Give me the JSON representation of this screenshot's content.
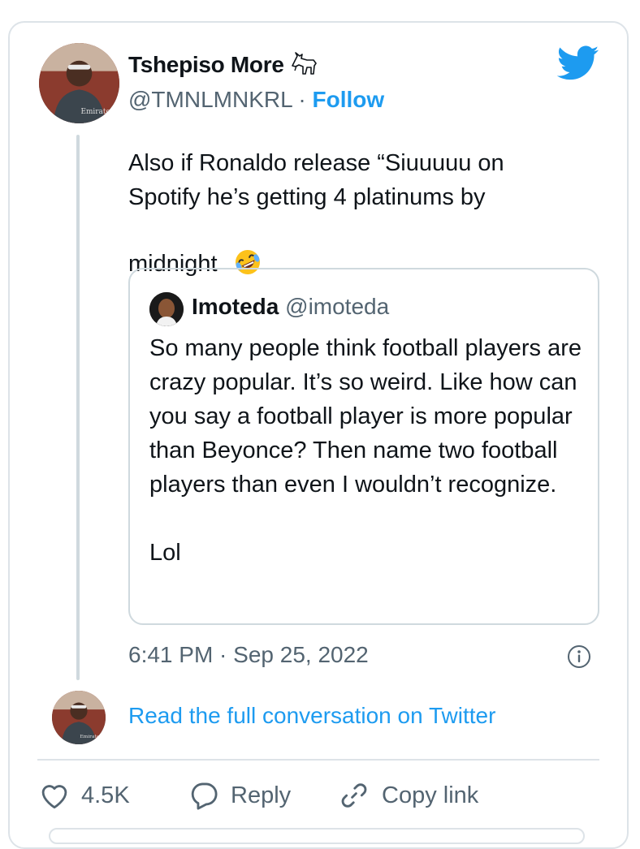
{
  "tweet": {
    "author_name": "Tshepiso More",
    "author_badge_icon": "goat-emoji",
    "handle": "@TMNLMNKRL",
    "separator": " · ",
    "follow_label": "Follow",
    "text": "Also if Ronaldo release “Siuuuuu on Spotify he’s getting 4 platinums by midnight",
    "text_emoji": "rolling-on-floor-laughing-emoji",
    "timestamp": "6:41 PM · Sep 25, 2022"
  },
  "quoted_tweet": {
    "author_name": "Imoteda",
    "handle": "@imoteda",
    "text": "So many people think football players are crazy popular. It’s so weird. Like how can you say a football player is more popular than Beyonce? Then name two football players than even I wouldn’t recognize.\n\nLol"
  },
  "read_full_conversation": "Read the full conversation on Twitter",
  "actions": {
    "like_count": "4.5K",
    "reply_label": "Reply",
    "copy_link_label": "Copy link"
  },
  "colors": {
    "accent": "#1d9bf0",
    "secondary_text": "#536471",
    "border": "#dde3e8"
  }
}
